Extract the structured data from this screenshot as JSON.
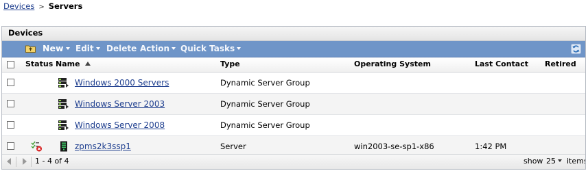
{
  "breadcrumb": {
    "parent": "Devices",
    "separator": ">",
    "current": "Servers"
  },
  "panel": {
    "title": "Devices"
  },
  "toolbar": {
    "new_label": "New",
    "edit_label": "Edit",
    "delete_label": "Delete",
    "action_label": "Action",
    "quick_tasks_label": "Quick Tasks",
    "folder_icon": "folder-up-icon",
    "refresh_icon": "refresh-icon"
  },
  "table": {
    "headers": {
      "status": "Status",
      "name": "Name",
      "type": "Type",
      "os": "Operating System",
      "last_contact": "Last Contact",
      "retired": "Retired"
    },
    "sort": {
      "column": "Name",
      "direction": "ascending"
    },
    "rows": [
      {
        "status": "",
        "icon": "server-group-icon",
        "name": "Windows 2000 Servers",
        "type": "Dynamic Server Group",
        "os": "",
        "last_contact": "",
        "retired": ""
      },
      {
        "status": "",
        "icon": "server-group-icon",
        "name": "Windows Server 2003",
        "type": "Dynamic Server Group",
        "os": "",
        "last_contact": "",
        "retired": ""
      },
      {
        "status": "",
        "icon": "server-group-icon",
        "name": "Windows Server 2008",
        "type": "Dynamic Server Group",
        "os": "",
        "last_contact": "",
        "retired": ""
      },
      {
        "status": "status-error-icon",
        "icon": "server-icon",
        "name": "zpms2k3ssp1",
        "type": "Server",
        "os": "win2003-se-sp1-x86",
        "last_contact": "1:42 PM",
        "retired": ""
      }
    ]
  },
  "footer": {
    "range": "1 - 4 of 4",
    "show_label": "show",
    "page_size": "25",
    "items_label": "items"
  },
  "colors": {
    "toolbar": "#6f95c8",
    "link": "#1f3f8f",
    "alt_row": "#f4f4f4"
  }
}
